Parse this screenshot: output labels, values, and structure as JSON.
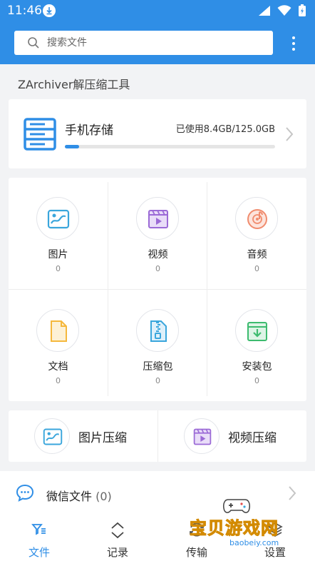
{
  "status_bar": {
    "time": "11:46"
  },
  "search": {
    "placeholder": "搜索文件"
  },
  "section_title": "ZArchiver解压缩工具",
  "storage": {
    "name": "手机存储",
    "usage": "已使用8.4GB/125.0GB",
    "used_fraction": 0.067
  },
  "categories": [
    {
      "label": "图片",
      "count": "0",
      "icon": "image-icon",
      "color": "#3aa6dc"
    },
    {
      "label": "视频",
      "count": "0",
      "icon": "video-icon",
      "color": "#9b6ad6"
    },
    {
      "label": "音频",
      "count": "0",
      "icon": "music-icon",
      "color": "#f08c6e"
    },
    {
      "label": "文档",
      "count": "0",
      "icon": "document-icon",
      "color": "#f5b83d"
    },
    {
      "label": "压缩包",
      "count": "0",
      "icon": "zip-icon",
      "color": "#3aa6dc"
    },
    {
      "label": "安装包",
      "count": "0",
      "icon": "apk-icon",
      "color": "#3dbb6f"
    }
  ],
  "compress": [
    {
      "label": "图片压缩",
      "icon": "image-icon"
    },
    {
      "label": "视频压缩",
      "icon": "video-icon"
    }
  ],
  "wechat": {
    "label": "微信文件",
    "count": "(0)"
  },
  "bottom_nav": [
    {
      "label": "文件",
      "icon": "files-icon",
      "active": true
    },
    {
      "label": "记录",
      "icon": "history-icon",
      "active": false
    },
    {
      "label": "传输",
      "icon": "transfer-icon",
      "active": false
    },
    {
      "label": "设置",
      "icon": "settings-icon",
      "active": false
    }
  ],
  "watermark": {
    "text": "宝贝游戏网",
    "url": "baobeiy.com"
  },
  "colors": {
    "primary": "#2f8ee6",
    "background": "#f2f3f5"
  }
}
